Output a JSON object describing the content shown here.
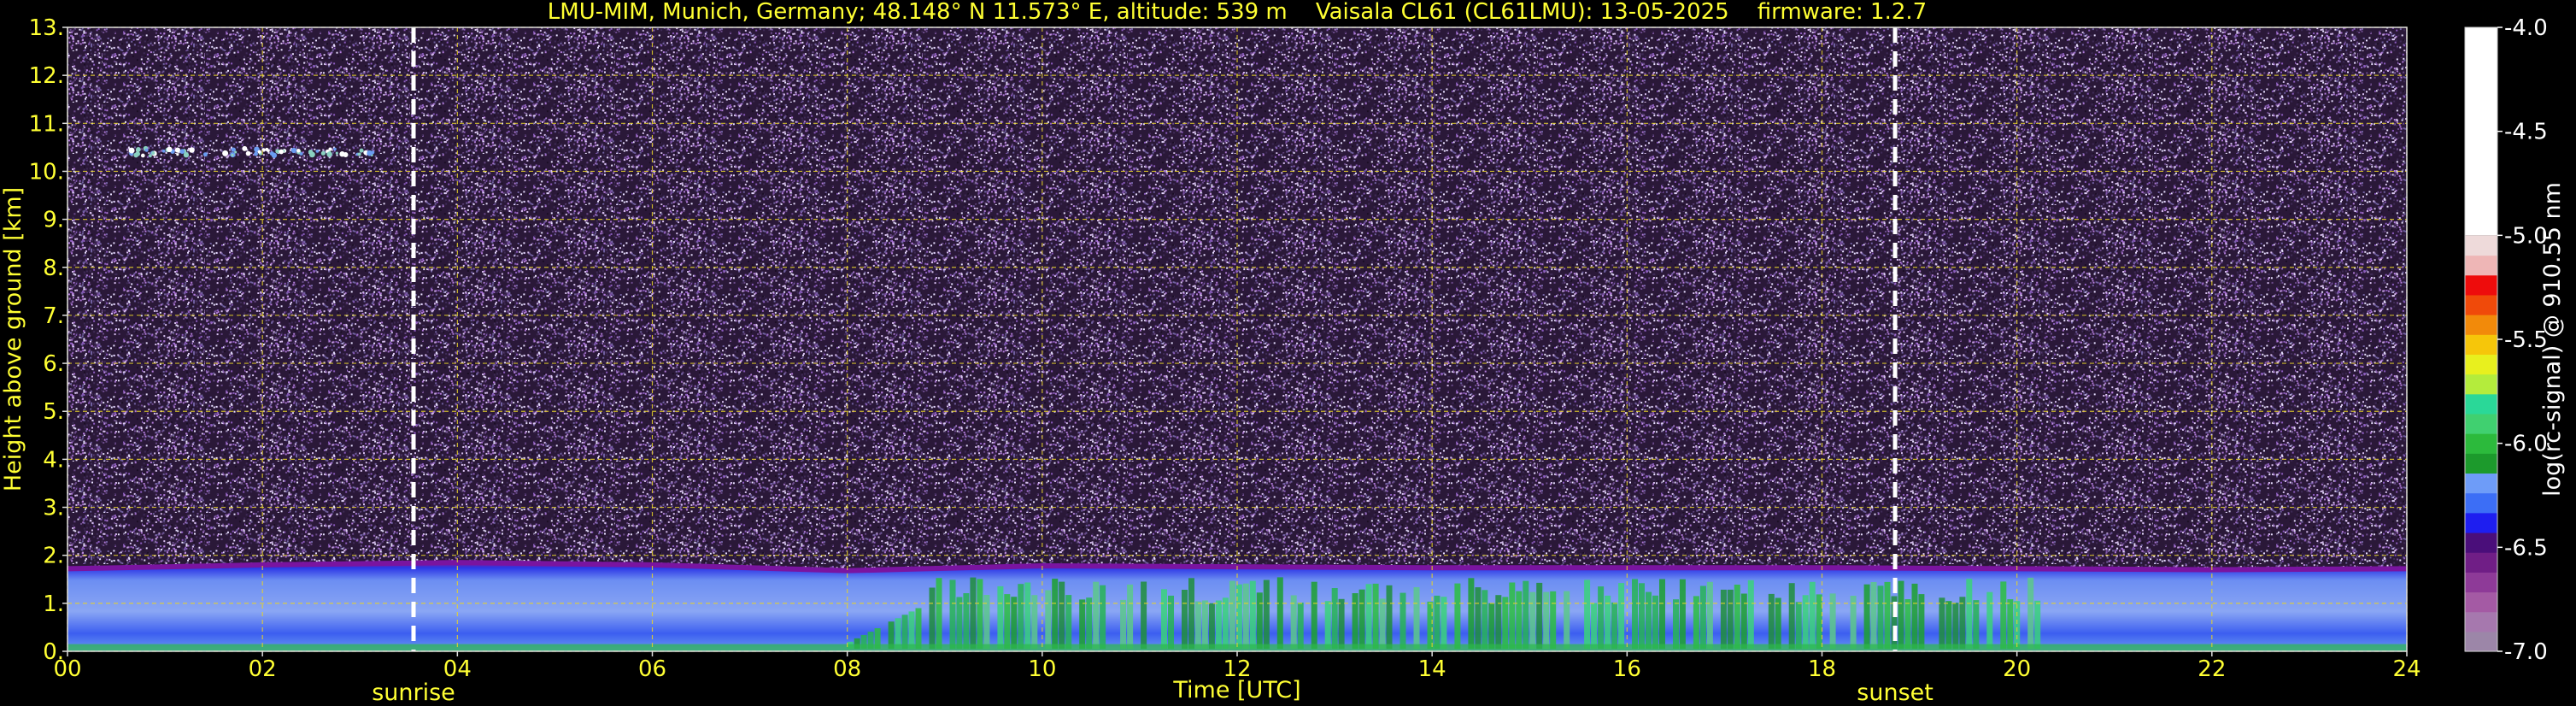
{
  "chart_data": [
    {
      "type": "heatmap",
      "title": "LMU-MIM, Munich, Germany; 48.148° N 11.573° E, altitude: 539 m    Vaisala CL61 (CL61LMU): 13-05-2025    firmware: 1.2.7",
      "xlabel": "Time [UTC]",
      "ylabel": "Height above ground [km]",
      "x_ticks": [
        "00",
        "02",
        "04",
        "06",
        "08",
        "10",
        "12",
        "14",
        "16",
        "18",
        "20",
        "22",
        "24"
      ],
      "x_tick_values": [
        0,
        2,
        4,
        6,
        8,
        10,
        12,
        14,
        16,
        18,
        20,
        22,
        24
      ],
      "y_ticks": [
        "0.",
        "1.",
        "2.",
        "3.",
        "4.",
        "5.",
        "6.",
        "7.",
        "8.",
        "9.",
        "10.",
        "11.",
        "12.",
        "13."
      ],
      "y_tick_values": [
        0,
        1,
        2,
        3,
        4,
        5,
        6,
        7,
        8,
        9,
        10,
        11,
        12,
        13
      ],
      "xlim": [
        0,
        24
      ],
      "ylim": [
        0,
        13
      ],
      "grid": true,
      "annotations": [
        {
          "label": "sunrise",
          "time": 3.55
        },
        {
          "label": "sunset",
          "time": 18.75
        }
      ],
      "boundary_layer_top_km": [
        {
          "time": 0,
          "height": 1.72
        },
        {
          "time": 2,
          "height": 1.8
        },
        {
          "time": 4,
          "height": 1.85
        },
        {
          "time": 6,
          "height": 1.8
        },
        {
          "time": 8,
          "height": 1.68
        },
        {
          "time": 8.8,
          "height": 1.72
        },
        {
          "time": 10,
          "height": 1.78
        },
        {
          "time": 12,
          "height": 1.76
        },
        {
          "time": 14,
          "height": 1.74
        },
        {
          "time": 16,
          "height": 1.74
        },
        {
          "time": 18,
          "height": 1.74
        },
        {
          "time": 20,
          "height": 1.72
        },
        {
          "time": 22,
          "height": 1.7
        },
        {
          "time": 24,
          "height": 1.72
        }
      ],
      "aerosol_layer_km": {
        "time_start": 0.6,
        "time_end": 3.2,
        "height": 10.4
      }
    },
    {
      "type": "colorbar",
      "label": "log(rc-signal) @ 910.55 nm",
      "ticks": [
        "-4.0",
        "-4.5",
        "-5.0",
        "-5.5",
        "-6.0",
        "-6.5",
        "-7.0"
      ],
      "tick_values": [
        -4.0,
        -4.5,
        -5.0,
        -5.5,
        -6.0,
        -6.5,
        -7.0
      ],
      "range": [
        -7.0,
        -4.0
      ],
      "colors": [
        "#9c86a8",
        "#a678ae",
        "#a45aa4",
        "#8e3a98",
        "#701e86",
        "#4a0e7a",
        "#1e1ef0",
        "#3c6ef6",
        "#6e9cf8",
        "#1c9a2c",
        "#2cba3c",
        "#40d070",
        "#2ad898",
        "#b4ec3c",
        "#e8f01e",
        "#f6c60a",
        "#f28a0a",
        "#f04a0a",
        "#ee0c0c",
        "#eeb6b6",
        "#eedada",
        "#ffffff"
      ]
    }
  ]
}
